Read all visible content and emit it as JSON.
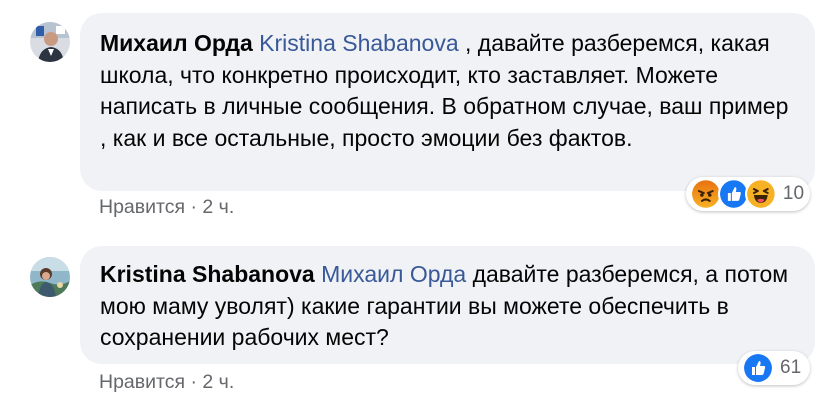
{
  "comments": [
    {
      "author": "Михаил Орда",
      "mention": "Kristina Shabanova",
      "text": " , давайте разберемся, какая школа, что конкретно происходит, кто заставляет. Можете написать в личные сообщения. В обратном случае, ваш пример , как и все остальные, просто эмоции без фактов.",
      "like_label": "Нравится",
      "separator": " · ",
      "time": "2 ч.",
      "reaction_count": "10",
      "reactions": [
        "angry-icon",
        "like-icon",
        "haha-icon"
      ]
    },
    {
      "author": "Kristina Shabanova",
      "mention": "Михаил Орда",
      "text": " давайте разберемся, а потом мою маму уволят) какие гарантии вы можете обеспечить в сохранении рабочих мест?",
      "like_label": "Нравится",
      "separator": " · ",
      "time": "2 ч.",
      "reaction_count": "61",
      "reactions": [
        "like-icon"
      ]
    }
  ],
  "colors": {
    "bubble": "#f0f2f5",
    "mention": "#385898",
    "meta": "#65676b",
    "like_blue": "#1877f2",
    "angry_top": "#e9710f",
    "haha_yellow": "#f7b125"
  }
}
